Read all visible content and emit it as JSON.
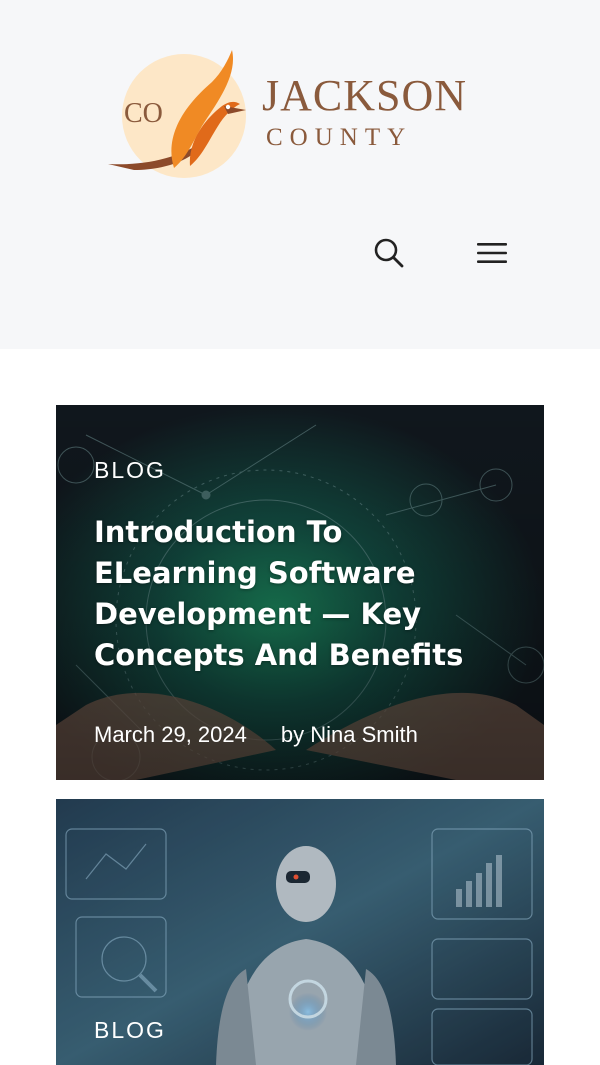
{
  "header": {
    "logo": {
      "monogram": "CO",
      "line1": "JACKSON",
      "line2": "COUNTY"
    },
    "search_icon": "search-icon",
    "menu_icon": "hamburger-menu-icon"
  },
  "posts": [
    {
      "category": "BLOG",
      "title": "Introduction To ELearning Software Development — Key Concepts And Benefits",
      "date": "March 29, 2024",
      "author": "by Nina Smith"
    },
    {
      "category": "BLOG"
    }
  ],
  "colors": {
    "header_bg": "#f6f7f9",
    "logo_text": "#8a5a3c",
    "logo_orange": "#f08a24",
    "logo_brown": "#8c4a2a",
    "logo_circle": "#fde7c7"
  }
}
